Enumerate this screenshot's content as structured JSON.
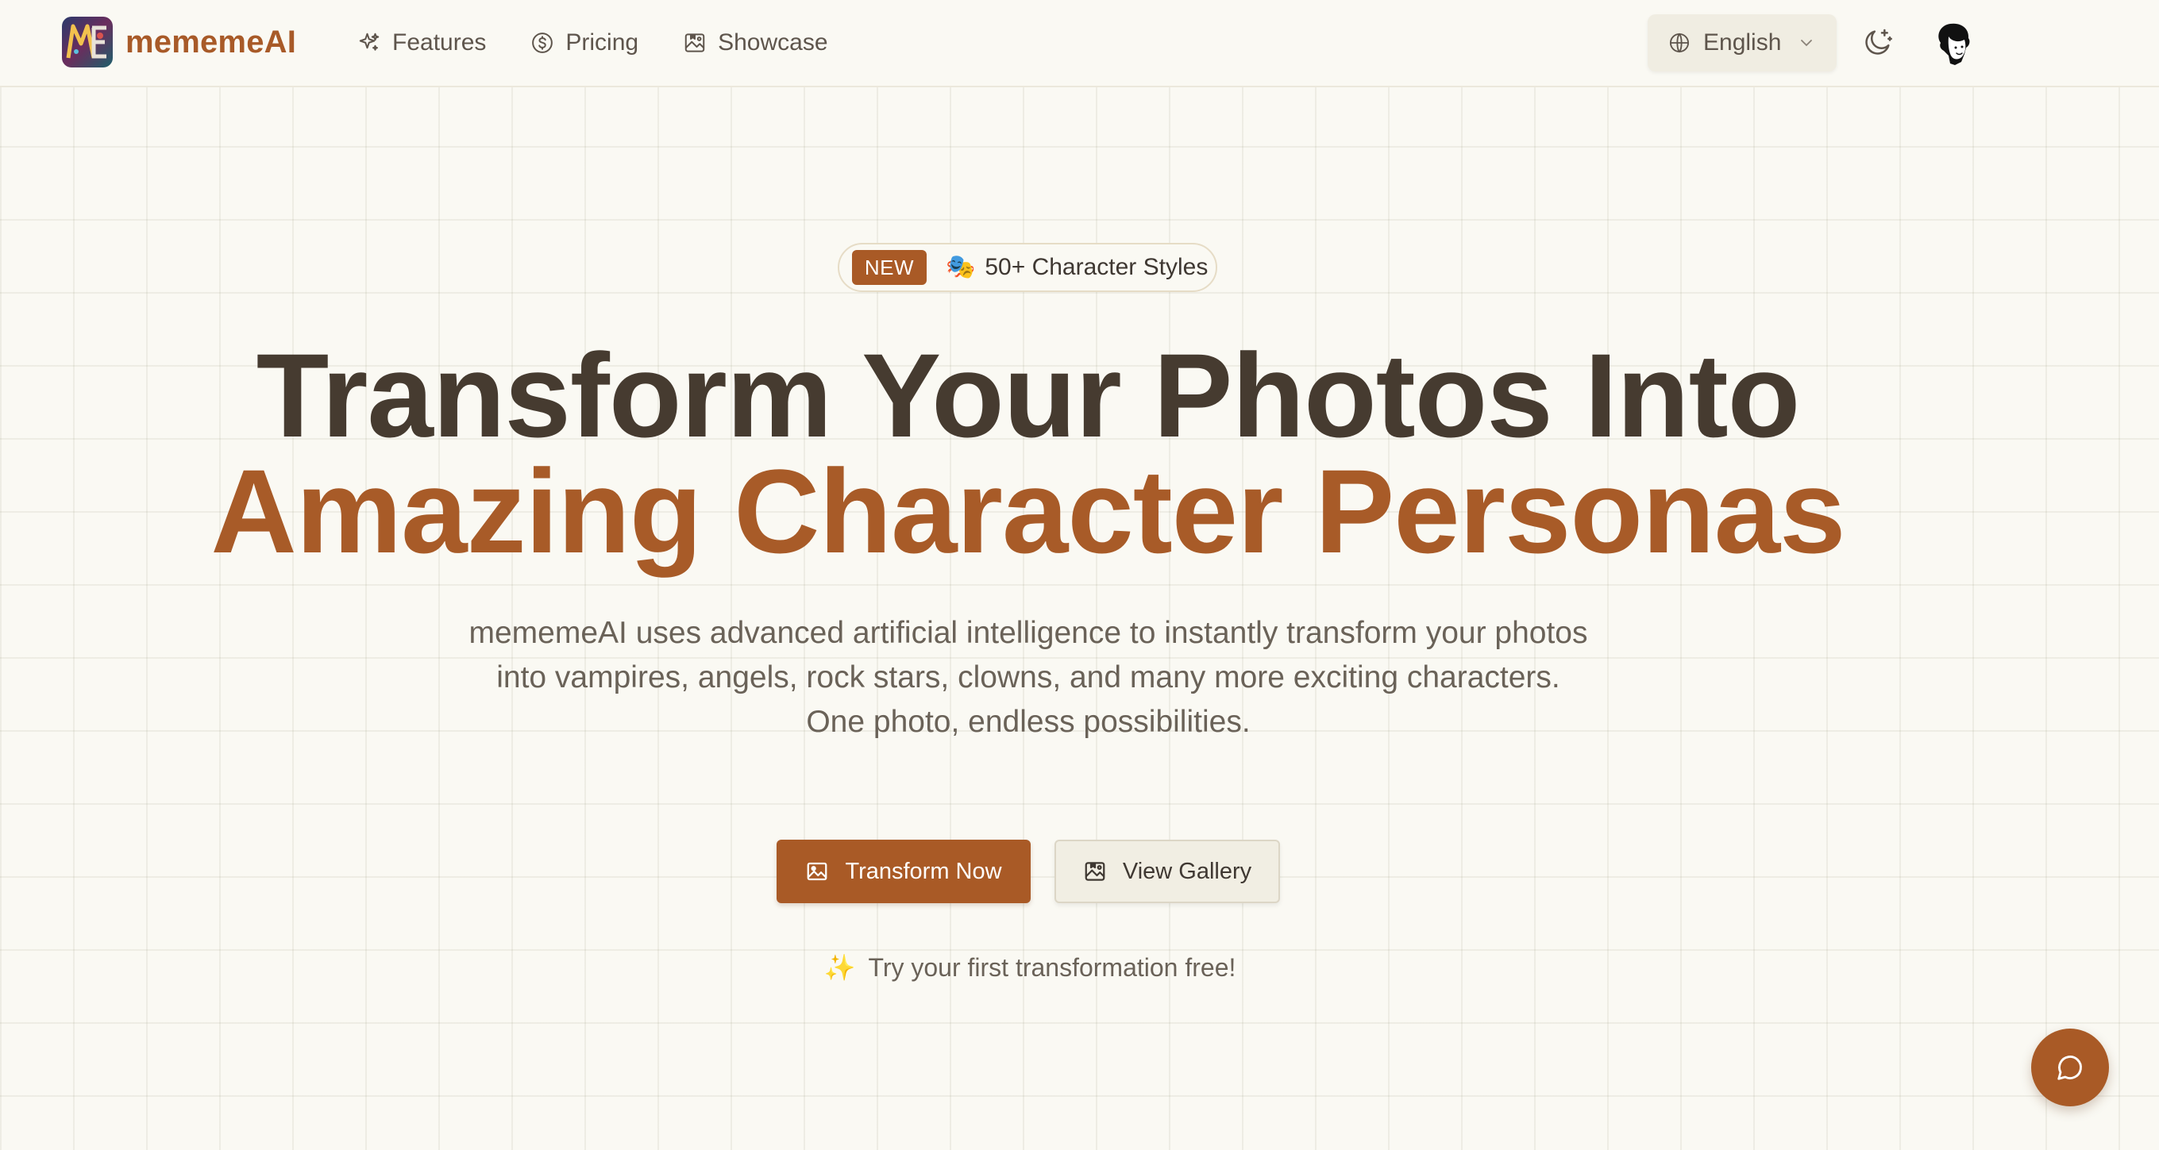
{
  "brand": {
    "name": "mememeAI",
    "logo_icon": "mememe-logo-icon",
    "accent_color": "#a85a28"
  },
  "nav": {
    "items": [
      {
        "label": "Features",
        "icon": "sparkles-icon"
      },
      {
        "label": "Pricing",
        "icon": "dollar-circle-icon"
      },
      {
        "label": "Showcase",
        "icon": "gallery-icon"
      }
    ]
  },
  "language": {
    "selected": "English",
    "icon": "globe-icon"
  },
  "theme_toggle": {
    "icon": "moon-sparkle-icon"
  },
  "user": {
    "icon": "user-avatar-icon"
  },
  "hero": {
    "badge": {
      "tag": "NEW",
      "emoji": "🎭",
      "text": "50+ Character Styles"
    },
    "headline_line1": "Transform Your Photos Into",
    "headline_line2": "Amazing Character Personas",
    "description_lines": [
      "mememeAI uses advanced artificial intelligence to instantly transform your photos into vampires, angels, rock stars, clowns, and many more exciting characters.",
      "One photo, endless possibilities."
    ],
    "primary_button": {
      "label": "Transform Now",
      "icon": "image-icon"
    },
    "secondary_button": {
      "label": "View Gallery",
      "icon": "gallery-icon"
    },
    "trial_emoji": "✨",
    "trial_text": "Try your first transformation free!"
  },
  "chat_button": {
    "icon": "chat-bubble-icon"
  },
  "colors": {
    "background": "#faf9f3",
    "heading": "#463b30",
    "accent": "#a95a26",
    "body_text": "#6a6258"
  }
}
